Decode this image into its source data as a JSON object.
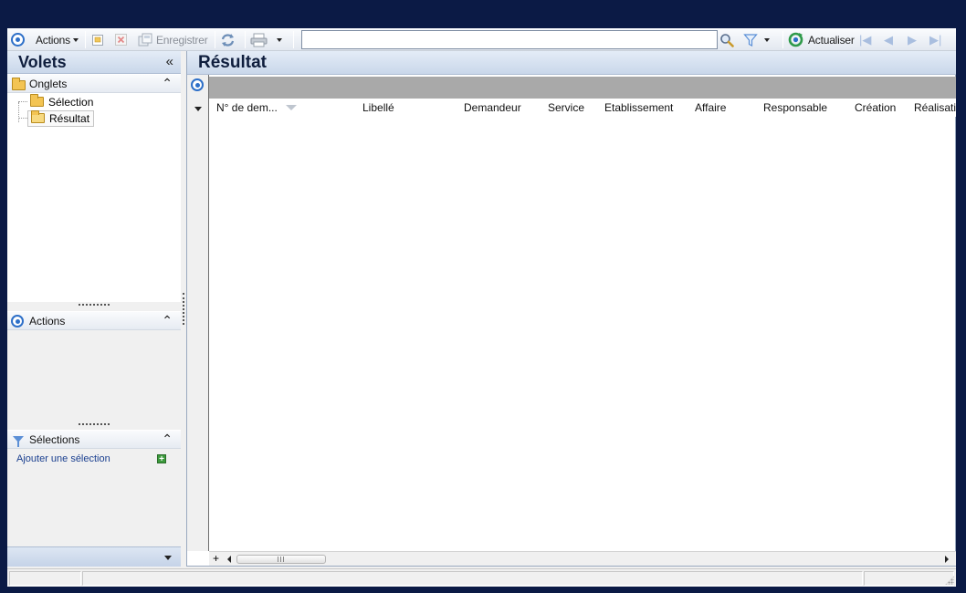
{
  "toolbar": {
    "actions_label": "Actions",
    "save_label": "Enregistrer",
    "search_value": "",
    "refresh_label": "Actualiser"
  },
  "left_pane": {
    "title": "Volets",
    "collapse_glyph": "«",
    "onglets": {
      "label": "Onglets",
      "items": [
        {
          "label": "Sélection",
          "selected": false
        },
        {
          "label": "Résultat",
          "selected": true
        }
      ]
    },
    "actions": {
      "label": "Actions"
    },
    "selections": {
      "label": "Sélections",
      "add_link": "Ajouter une sélection"
    }
  },
  "main": {
    "title": "Résultat",
    "group_hint": "",
    "columns": [
      "N° de dem...",
      "Libellé",
      "Demandeur",
      "Service",
      "Etablissement",
      "Affaire",
      "Responsable",
      "Création",
      "Réalisati"
    ],
    "sorted_column": "N° de dem...",
    "rows": []
  },
  "statusbar": {
    "cells": [
      "",
      "",
      ""
    ]
  },
  "colors": {
    "background": "#0b1a45",
    "header_gradient_top": "#e4ecf7",
    "header_gradient_bottom": "#c9d7ea",
    "group_bar": "#a9a9a9",
    "accent": "#2d6fc8"
  },
  "icons": [
    "target-icon",
    "new-document-icon",
    "delete-icon",
    "save-icon",
    "sync-icon",
    "print-icon",
    "search-icon",
    "filter-icon",
    "refresh-icon",
    "first-page-icon",
    "previous-page-icon",
    "next-page-icon",
    "last-page-icon",
    "folder-icon",
    "open-folder-icon",
    "funnel-icon",
    "add-icon"
  ]
}
